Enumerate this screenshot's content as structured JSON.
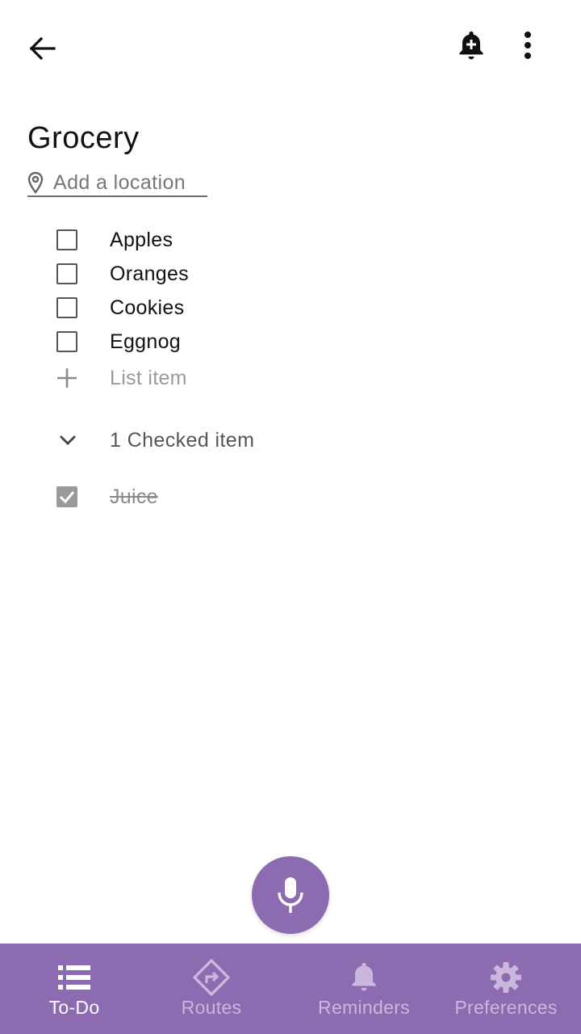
{
  "header": {
    "back_icon": "arrow-left-icon",
    "reminder_icon": "bell-plus-icon",
    "more_icon": "more-vertical-icon"
  },
  "note": {
    "title": "Grocery",
    "location_placeholder": "Add a location",
    "location_icon": "map-pin-icon"
  },
  "items": [
    {
      "label": "Apples",
      "checked": false
    },
    {
      "label": "Oranges",
      "checked": false
    },
    {
      "label": "Cookies",
      "checked": false
    },
    {
      "label": "Eggnog",
      "checked": false
    }
  ],
  "add_item": {
    "placeholder": "List item",
    "icon": "plus-icon"
  },
  "checked_section": {
    "header": "1 Checked item",
    "icon": "chevron-down-icon",
    "items": [
      {
        "label": "Juice",
        "checked": true
      }
    ]
  },
  "fab": {
    "icon": "microphone-icon"
  },
  "bottom_nav": {
    "items": [
      {
        "label": "To-Do",
        "icon": "list-icon",
        "active": true
      },
      {
        "label": "Routes",
        "icon": "directions-icon",
        "active": false
      },
      {
        "label": "Reminders",
        "icon": "bell-icon",
        "active": false
      },
      {
        "label": "Preferences",
        "icon": "gear-icon",
        "active": false
      }
    ]
  },
  "colors": {
    "accent": "#8c6bb1",
    "nav_active": "#ffffff",
    "nav_inactive": "#c9b7de",
    "checked_gray": "#9a9a9a"
  }
}
